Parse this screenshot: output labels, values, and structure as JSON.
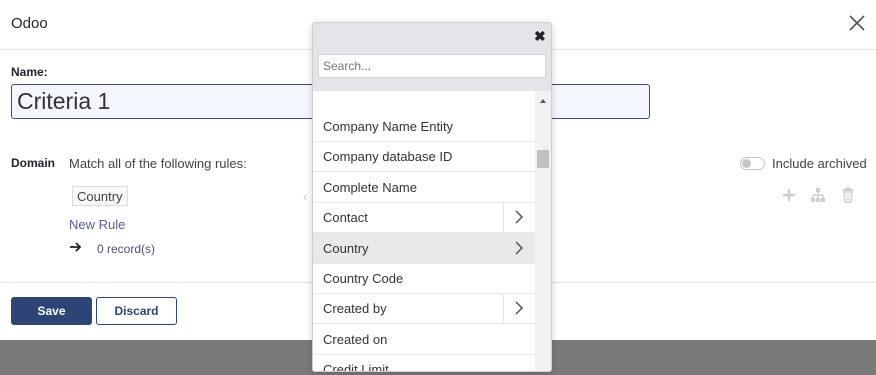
{
  "dialog": {
    "title": "Odoo",
    "name_label": "Name:",
    "name_value": "Criteria 1",
    "domain_label": "Domain",
    "match_text": "Match all of the following rules:",
    "rule_field": "Country",
    "new_rule": "New Rule",
    "records_count": "0 record(s)",
    "include_archived_label": "Include archived",
    "include_archived_on": false,
    "save_label": "Save",
    "discard_label": "Discard"
  },
  "field_selector": {
    "search_placeholder": "Search...",
    "items": [
      {
        "label": "Company Name Entity",
        "has_children": false,
        "selected": false
      },
      {
        "label": "Company database ID",
        "has_children": false,
        "selected": false
      },
      {
        "label": "Complete Name",
        "has_children": false,
        "selected": false
      },
      {
        "label": "Contact",
        "has_children": true,
        "selected": false
      },
      {
        "label": "Country",
        "has_children": true,
        "selected": true
      },
      {
        "label": "Country Code",
        "has_children": false,
        "selected": false
      },
      {
        "label": "Created by",
        "has_children": true,
        "selected": false
      },
      {
        "label": "Created on",
        "has_children": false,
        "selected": false
      },
      {
        "label": "Credit Limit",
        "has_children": false,
        "selected": false
      }
    ]
  },
  "colors": {
    "primary": "#2c4576",
    "link": "#5a5e91"
  }
}
